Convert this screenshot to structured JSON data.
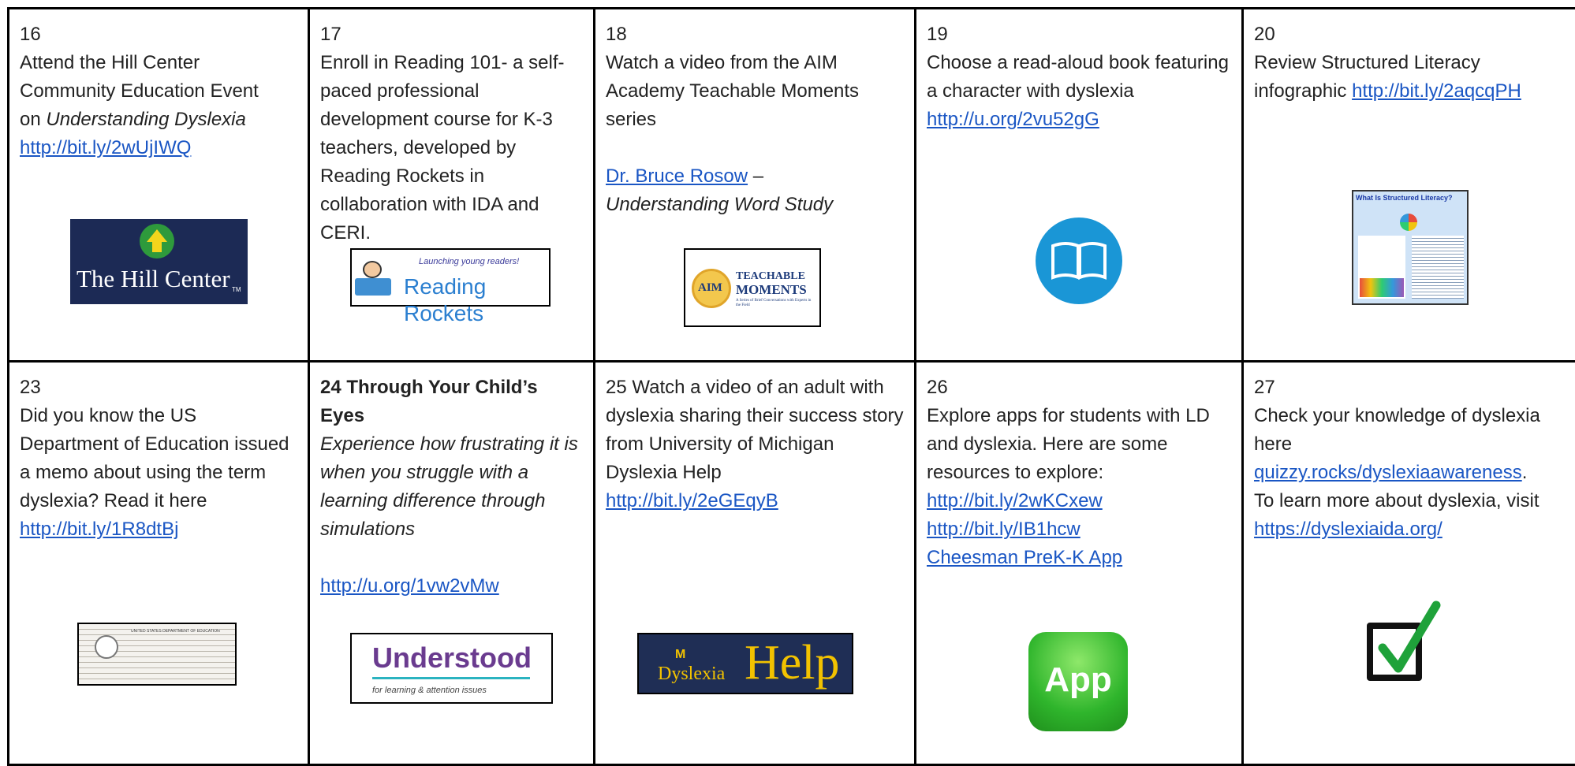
{
  "row1": [
    {
      "num": "16",
      "l1": "Attend the Hill Center",
      "l2": "Community Education Event",
      "l3a": "on ",
      "l3b": "Understanding Dyslexia",
      "link": "http://bit.ly/2wUjIWQ",
      "logo": "The Hill Center",
      "logo_sm": "TM"
    },
    {
      "num": "17",
      "text": "Enroll in Reading 101- a self-paced professional development course for K-3 teachers, developed by Reading Rockets in collaboration with IDA and CERI.",
      "logo_tag": "Launching young readers!",
      "logo": "Reading Rockets"
    },
    {
      "num": "18",
      "text": "Watch  a video from the AIM Academy Teachable Moments series",
      "link": "Dr. Bruce Rosow",
      "dash": " –",
      "sub": "Understanding Word Study",
      "logo1": "TEACHABLE",
      "logo2": "MOMENTS",
      "logo3": "A Series of Brief Conversations with Experts in the Field",
      "logo_badge": "AIM"
    },
    {
      "num": "19",
      "text": "Choose a read-aloud book featuring a character with dyslexia",
      "link": "http://u.org/2vu52gG",
      "icon": "open-book-icon"
    },
    {
      "num": "20",
      "text": "Review Structured Literacy infographic ",
      "link": "http://bit.ly/2aqcqPH",
      "thumb_title": "What Is Structured Literacy?"
    }
  ],
  "row2": [
    {
      "num": "23",
      "text": "Did you know the US Department of Education issued a memo about using the term dyslexia?  Read it here",
      "link": "http://bit.ly/1R8dtBj",
      "thumb": "UNITED STATES DEPARTMENT OF EDUCATION"
    },
    {
      "num": "24 Through Your Child’s Eyes",
      "sub": "Experience how frustrating it is when you struggle with a learning difference through simulations",
      "link": "http://u.org/1vw2vMw",
      "logo": "Understood",
      "logo_sub": "for learning & attention issues"
    },
    {
      "num": "25",
      "text": "  Watch a video of an adult with dyslexia sharing their success story from University of Michigan Dyslexia Help",
      "link": "http://bit.ly/2eGEqyB",
      "logo_m": "M",
      "logo_a": "Dyslexia",
      "logo_b": "Help"
    },
    {
      "num": "26",
      "text": "Explore apps for students with LD and dyslexia.  Here are some resources to explore:",
      "links": [
        "http://bit.ly/2wKCxew",
        "http://bit.ly/IB1hcw",
        "Cheesman PreK-K App"
      ],
      "logo": "App"
    },
    {
      "num": "27",
      "text": "Check your knowledge of dyslexia here",
      "link": "quizzy.rocks/dyslexiaawareness",
      "after": ".",
      "text2": "To learn more about dyslexia, visit ",
      "link2": "https://dyslexiaida.org/"
    }
  ]
}
